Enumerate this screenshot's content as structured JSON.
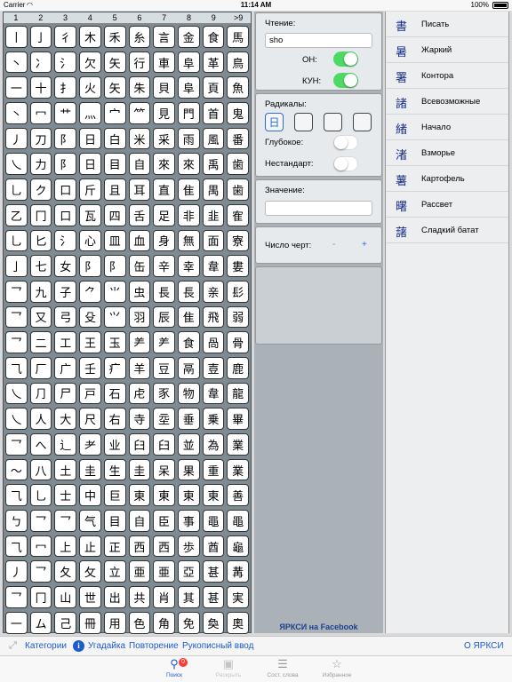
{
  "status_bar": {
    "carrier": "Carrier",
    "time": "11:14 AM",
    "battery": "100%"
  },
  "grid": {
    "headers": [
      "1",
      "2",
      "3",
      "4",
      "5",
      "6",
      "7",
      "8",
      "9",
      ">9"
    ],
    "rows": [
      [
        "丨",
        "亅",
        "彳",
        "木",
        "禾",
        "糸",
        "言",
        "金",
        "食",
        "馬"
      ],
      [
        "丶",
        "冫",
        "氵",
        "欠",
        "矢",
        "行",
        "車",
        "阜",
        "革",
        "鳥"
      ],
      [
        "一",
        "十",
        "扌",
        "火",
        "矢",
        "朱",
        "貝",
        "阜",
        "頁",
        "魚"
      ],
      [
        "丶",
        "冖",
        "艹",
        "灬",
        "宀",
        "⺮",
        "見",
        "門",
        "首",
        "鬼"
      ],
      [
        "丿",
        "刀",
        "阝",
        "日",
        "白",
        "米",
        "采",
        "雨",
        "風",
        "番"
      ],
      [
        "乀",
        "力",
        "阝",
        "日",
        "目",
        "自",
        "來",
        "來",
        "禹",
        "歯"
      ],
      [
        "乚",
        "ク",
        "口",
        "斤",
        "且",
        "耳",
        "直",
        "隹",
        "禺",
        "歯"
      ],
      [
        "乙",
        "冂",
        "口",
        "瓦",
        "四",
        "舌",
        "足",
        "非",
        "韭",
        "隺"
      ],
      [
        "乚",
        "匕",
        "氵",
        "心",
        "皿",
        "血",
        "身",
        "無",
        "面",
        "寮"
      ],
      [
        "亅",
        "七",
        "女",
        "⻖",
        "⻖",
        "缶",
        "辛",
        "幸",
        "韋",
        "婁"
      ],
      [
        "乛",
        "九",
        "子",
        "⺈",
        "⺌",
        "虫",
        "長",
        "長",
        "亲",
        "髟"
      ],
      [
        "乛",
        "又",
        "弓",
        "殳",
        "⺍",
        "羽",
        "辰",
        "隹",
        "飛",
        "弱"
      ],
      [
        "乛",
        "二",
        "工",
        "王",
        "玉",
        "⺶",
        "⺶",
        "食",
        "咼",
        "骨"
      ],
      [
        "⺄",
        "厂",
        "广",
        "壬",
        "疒",
        "羊",
        "豆",
        "鬲",
        "壴",
        "鹿"
      ],
      [
        "乀",
        "⺆",
        "尸",
        "戸",
        "石",
        "虍",
        "豕",
        "物",
        "韋",
        "龍"
      ],
      [
        "乀",
        "人",
        "大",
        "尺",
        "右",
        "寺",
        "坖",
        "垂",
        "乗",
        "畢"
      ],
      [
        "乛",
        "へ",
        "辶",
        "⺹",
        "业",
        "臼",
        "臼",
        "並",
        "為",
        "業"
      ],
      [
        "〜",
        "八",
        "土",
        "圭",
        "生",
        "圭",
        "呆",
        "果",
        "重",
        "業"
      ],
      [
        "⺄",
        "乚",
        "士",
        "中",
        "巨",
        "東",
        "東",
        "東",
        "東",
        "善"
      ],
      [
        "ㄅ",
        "乛",
        "乛",
        "气",
        "目",
        "自",
        "臣",
        "事",
        "黽",
        "黽"
      ],
      [
        "⺄",
        "冖",
        "上",
        "止",
        "正",
        "西",
        "西",
        "歩",
        "酋",
        "龜"
      ],
      [
        "丿",
        "乛",
        "夂",
        "攵",
        "立",
        "亜",
        "亜",
        "亞",
        "甚",
        "冓"
      ],
      [
        "乛",
        "冂",
        "山",
        "世",
        "出",
        "共",
        "肖",
        "其",
        "甚",
        "実"
      ],
      [
        "一",
        "ム",
        "己",
        "冊",
        "用",
        "色",
        "角",
        "免",
        "奐",
        "奧"
      ]
    ]
  },
  "reading_panel": {
    "label": "Чтение:",
    "value": "sho",
    "on_label": "ОН:",
    "kun_label": "КУН:",
    "on_enabled": true,
    "kun_enabled": true
  },
  "radicals_panel": {
    "label": "Радикалы:",
    "selected_radical": "日",
    "deep_label": "Глубокое:",
    "nonstandard_label": "Нестандарт:",
    "deep_enabled": false,
    "nonstandard_enabled": false
  },
  "meaning_panel": {
    "label": "Значение:",
    "value": ""
  },
  "strokes_panel": {
    "label": "Число черт:",
    "minus": "-",
    "plus": "+"
  },
  "facebook_link": "ЯРКСИ на Facebook",
  "results": [
    {
      "kanji": "書",
      "meaning": "Писать"
    },
    {
      "kanji": "暑",
      "meaning": "Жаркий"
    },
    {
      "kanji": "署",
      "meaning": "Контора"
    },
    {
      "kanji": "諸",
      "meaning": "Всевозможные"
    },
    {
      "kanji": "緒",
      "meaning": "Начало"
    },
    {
      "kanji": "渚",
      "meaning": "Взморье"
    },
    {
      "kanji": "薯",
      "meaning": "Картофель"
    },
    {
      "kanji": "曙",
      "meaning": "Рассвет"
    },
    {
      "kanji": "藷",
      "meaning": "Сладкий батат"
    }
  ],
  "toolbar": {
    "categories": "Категории",
    "guess": "Угадайка",
    "repeat": "Повторение",
    "handwriting": "Рукописный ввод",
    "about": "О ЯРКСИ"
  },
  "tabs": [
    {
      "label": "Поиск",
      "icon": "search-icon",
      "badge": "0"
    },
    {
      "label": "Раскрыть",
      "icon": "gift-icon"
    },
    {
      "label": "Сост. слова",
      "icon": "list-icon"
    },
    {
      "label": "Избранное",
      "icon": "star-icon"
    }
  ],
  "colors": {
    "accent": "#1f5ad1",
    "toggle_on": "#4cd964",
    "kanji_list": "#1b2f8a",
    "badge": "#ff3b30"
  }
}
